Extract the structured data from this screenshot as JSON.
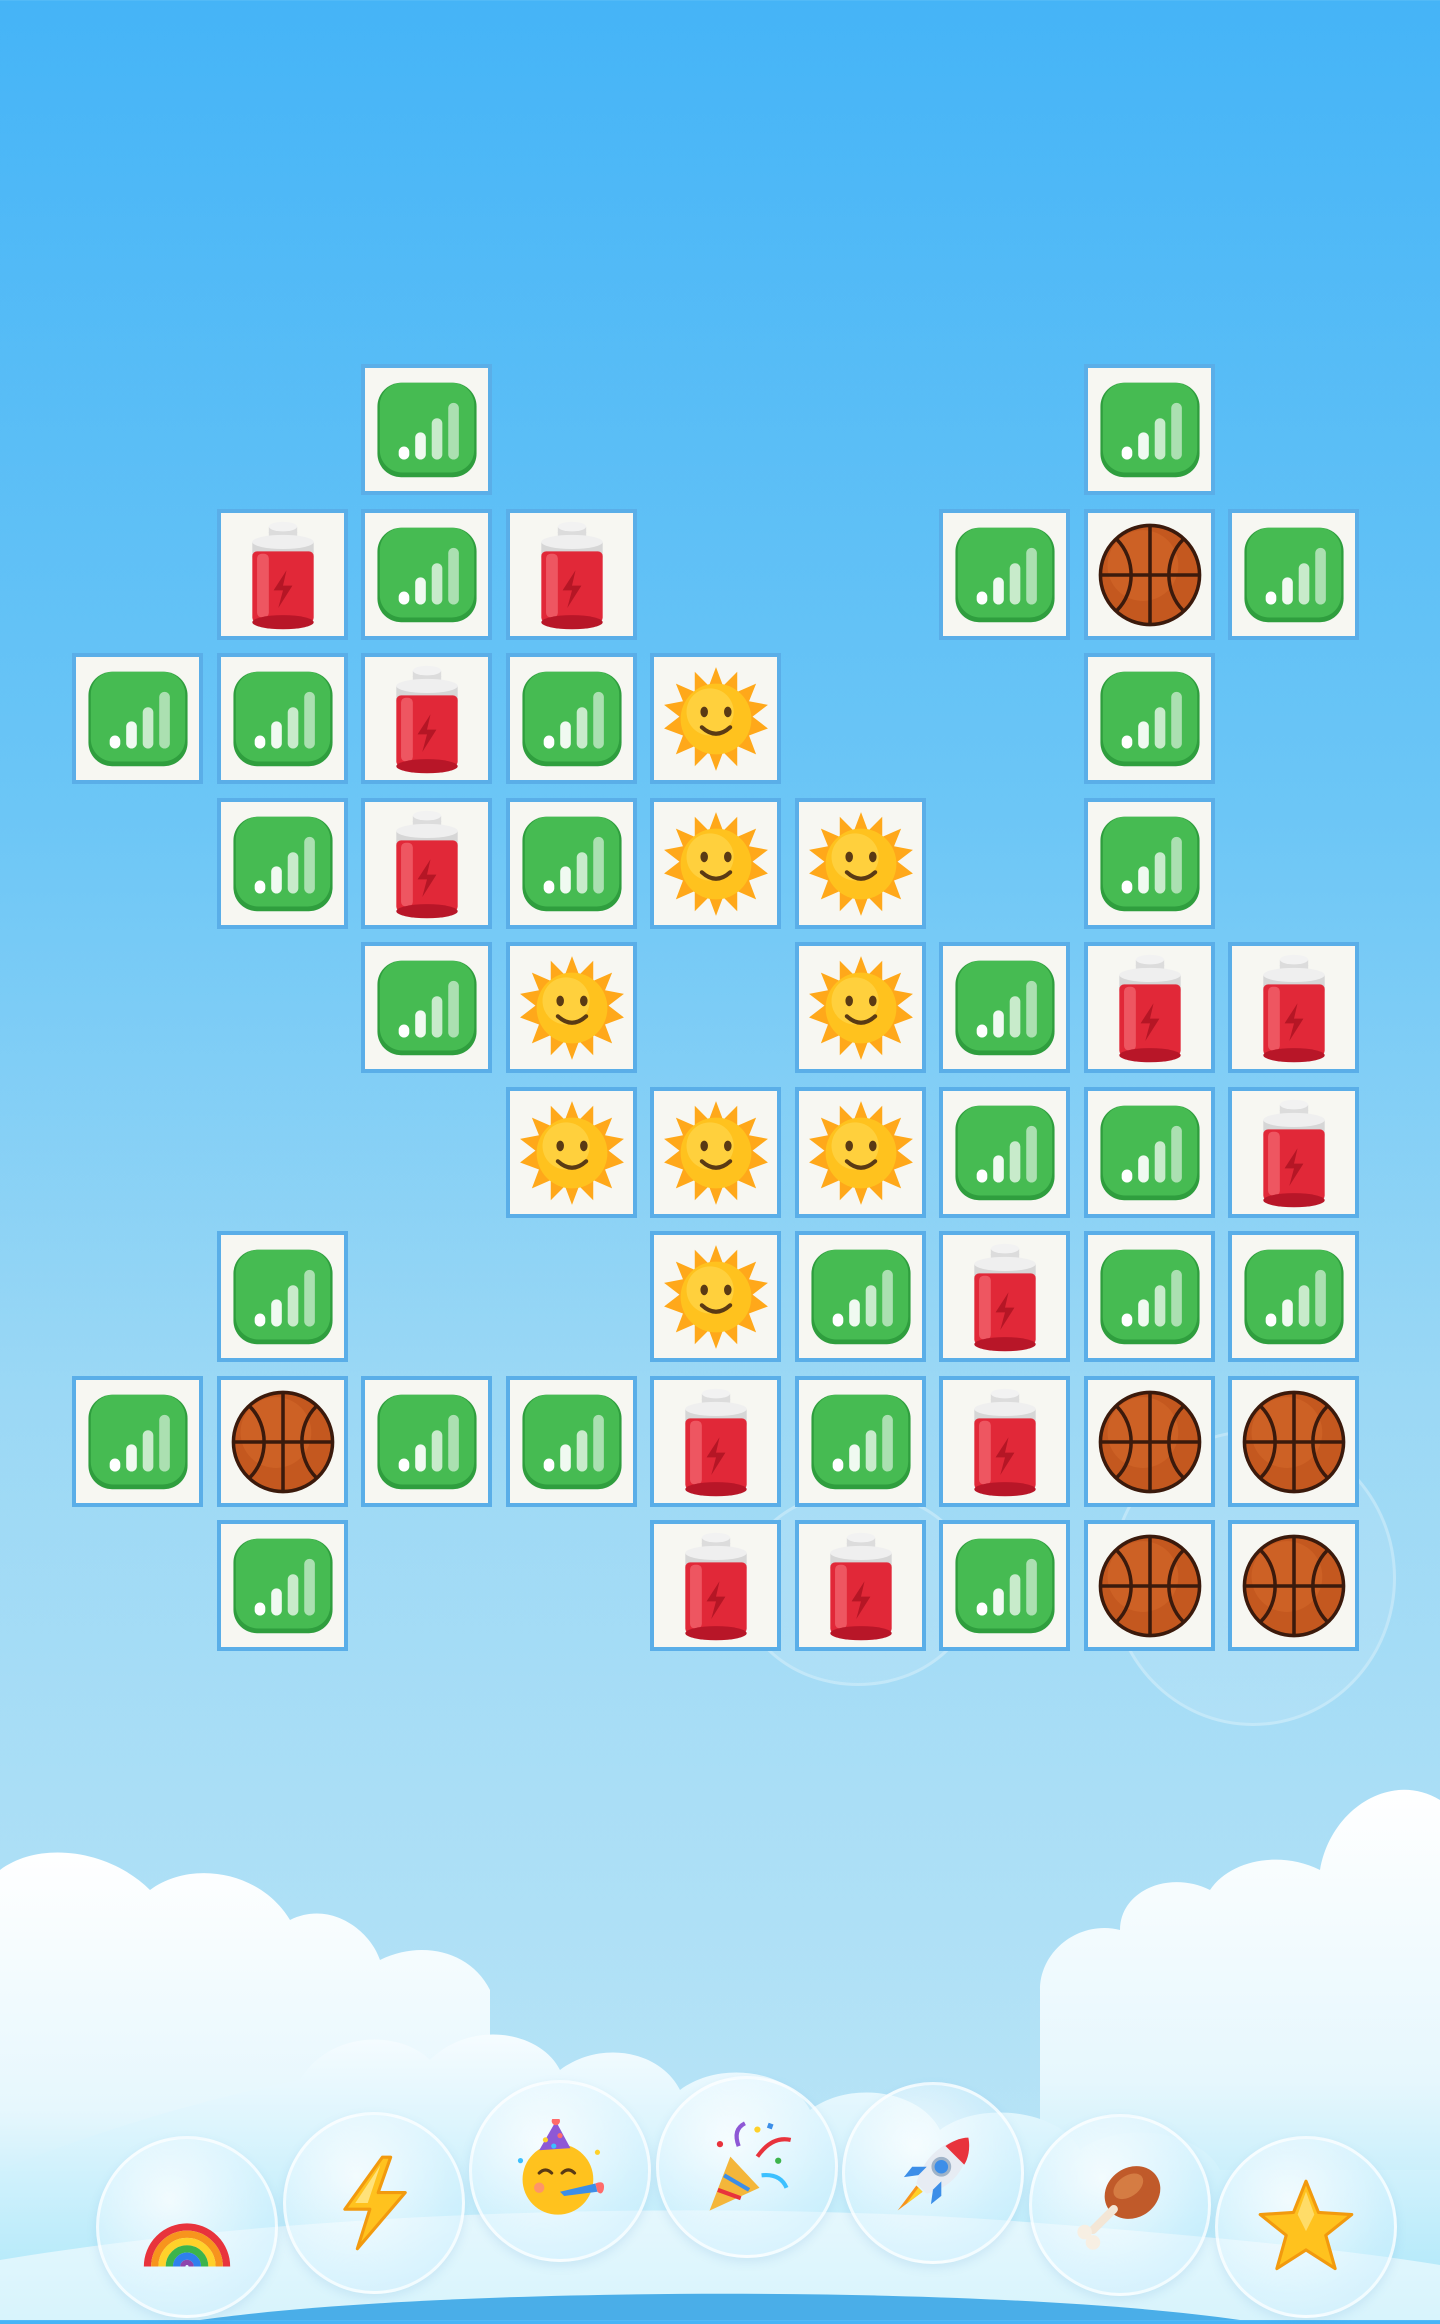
{
  "board": {
    "columns": 9,
    "rows": 9,
    "tiles": [
      {
        "row": 0,
        "col": 2,
        "icon": "signal-bars-icon"
      },
      {
        "row": 0,
        "col": 7,
        "icon": "signal-bars-icon"
      },
      {
        "row": 1,
        "col": 1,
        "icon": "battery-icon"
      },
      {
        "row": 1,
        "col": 2,
        "icon": "signal-bars-icon"
      },
      {
        "row": 1,
        "col": 3,
        "icon": "battery-icon"
      },
      {
        "row": 1,
        "col": 6,
        "icon": "signal-bars-icon"
      },
      {
        "row": 1,
        "col": 7,
        "icon": "basketball-icon"
      },
      {
        "row": 1,
        "col": 8,
        "icon": "signal-bars-icon"
      },
      {
        "row": 2,
        "col": 0,
        "icon": "signal-bars-icon"
      },
      {
        "row": 2,
        "col": 1,
        "icon": "signal-bars-icon"
      },
      {
        "row": 2,
        "col": 2,
        "icon": "battery-icon"
      },
      {
        "row": 2,
        "col": 3,
        "icon": "signal-bars-icon"
      },
      {
        "row": 2,
        "col": 4,
        "icon": "sun-icon"
      },
      {
        "row": 2,
        "col": 7,
        "icon": "signal-bars-icon"
      },
      {
        "row": 3,
        "col": 1,
        "icon": "signal-bars-icon"
      },
      {
        "row": 3,
        "col": 2,
        "icon": "battery-icon"
      },
      {
        "row": 3,
        "col": 3,
        "icon": "signal-bars-icon"
      },
      {
        "row": 3,
        "col": 4,
        "icon": "sun-icon"
      },
      {
        "row": 3,
        "col": 5,
        "icon": "sun-icon"
      },
      {
        "row": 3,
        "col": 7,
        "icon": "signal-bars-icon"
      },
      {
        "row": 4,
        "col": 2,
        "icon": "signal-bars-icon"
      },
      {
        "row": 4,
        "col": 3,
        "icon": "sun-icon"
      },
      {
        "row": 4,
        "col": 5,
        "icon": "sun-icon"
      },
      {
        "row": 4,
        "col": 6,
        "icon": "signal-bars-icon"
      },
      {
        "row": 4,
        "col": 7,
        "icon": "battery-icon"
      },
      {
        "row": 4,
        "col": 8,
        "icon": "battery-icon"
      },
      {
        "row": 5,
        "col": 3,
        "icon": "sun-icon"
      },
      {
        "row": 5,
        "col": 4,
        "icon": "sun-icon"
      },
      {
        "row": 5,
        "col": 5,
        "icon": "sun-icon"
      },
      {
        "row": 5,
        "col": 6,
        "icon": "signal-bars-icon"
      },
      {
        "row": 5,
        "col": 7,
        "icon": "signal-bars-icon"
      },
      {
        "row": 5,
        "col": 8,
        "icon": "battery-icon"
      },
      {
        "row": 6,
        "col": 1,
        "icon": "signal-bars-icon"
      },
      {
        "row": 6,
        "col": 4,
        "icon": "sun-icon"
      },
      {
        "row": 6,
        "col": 5,
        "icon": "signal-bars-icon"
      },
      {
        "row": 6,
        "col": 6,
        "icon": "battery-icon"
      },
      {
        "row": 6,
        "col": 7,
        "icon": "signal-bars-icon"
      },
      {
        "row": 6,
        "col": 8,
        "icon": "signal-bars-icon"
      },
      {
        "row": 7,
        "col": 0,
        "icon": "signal-bars-icon"
      },
      {
        "row": 7,
        "col": 1,
        "icon": "basketball-icon"
      },
      {
        "row": 7,
        "col": 2,
        "icon": "signal-bars-icon"
      },
      {
        "row": 7,
        "col": 3,
        "icon": "signal-bars-icon"
      },
      {
        "row": 7,
        "col": 4,
        "icon": "battery-icon"
      },
      {
        "row": 7,
        "col": 5,
        "icon": "signal-bars-icon"
      },
      {
        "row": 7,
        "col": 6,
        "icon": "battery-icon"
      },
      {
        "row": 7,
        "col": 7,
        "icon": "basketball-icon"
      },
      {
        "row": 7,
        "col": 8,
        "icon": "basketball-icon"
      },
      {
        "row": 8,
        "col": 1,
        "icon": "signal-bars-icon"
      },
      {
        "row": 8,
        "col": 4,
        "icon": "battery-icon"
      },
      {
        "row": 8,
        "col": 5,
        "icon": "battery-icon"
      },
      {
        "row": 8,
        "col": 6,
        "icon": "signal-bars-icon"
      },
      {
        "row": 8,
        "col": 7,
        "icon": "basketball-icon"
      },
      {
        "row": 8,
        "col": 8,
        "icon": "basketball-icon"
      }
    ]
  },
  "toolbar": {
    "tools": [
      {
        "icon": "rainbow-icon"
      },
      {
        "icon": "lightning-icon"
      },
      {
        "icon": "party-face-icon"
      },
      {
        "icon": "party-popper-icon"
      },
      {
        "icon": "rocket-icon"
      },
      {
        "icon": "drumstick-icon"
      },
      {
        "icon": "star-icon"
      }
    ]
  },
  "colors": {
    "sky_top": "#45b4f7",
    "sky_bottom": "#bde6f7",
    "tile_background": "#f7f7f2",
    "tile_border": "#5aaee8",
    "signal_green": "#3fb54a",
    "battery_red": "#e8283a",
    "basketball_orange": "#c4581f",
    "sun_yellow": "#ffc21e"
  }
}
